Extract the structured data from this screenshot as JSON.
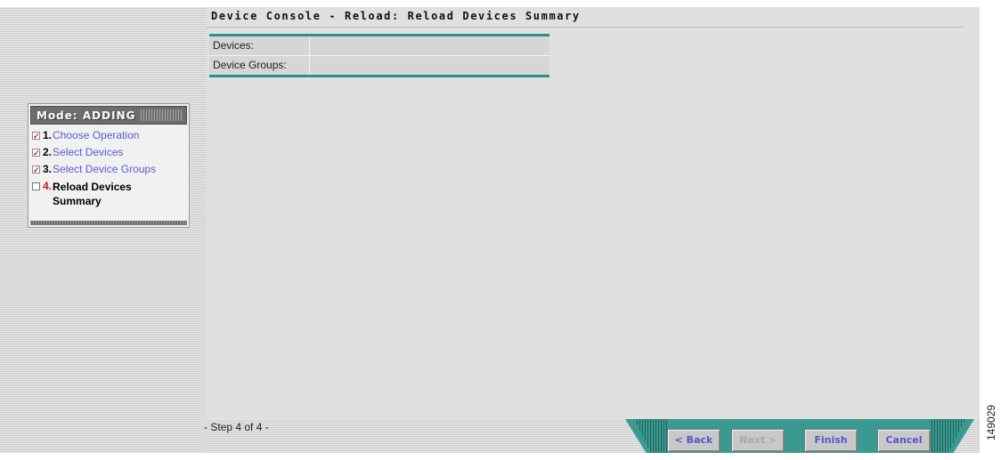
{
  "header": {
    "title": "Device Console - Reload: Reload Devices Summary"
  },
  "summary": {
    "rows": [
      {
        "label": "Devices:",
        "value": ""
      },
      {
        "label": "Device Groups:",
        "value": ""
      }
    ]
  },
  "wizard": {
    "mode_label": "Mode: ADDING",
    "steps": [
      {
        "number": "1.",
        "label": "Choose Operation",
        "done": true
      },
      {
        "number": "2.",
        "label": "Select Devices",
        "done": true
      },
      {
        "number": "3.",
        "label": "Select Device Groups",
        "done": true
      },
      {
        "number": "4.",
        "label_line1": "Reload Devices",
        "label_line2": "Summary",
        "done": false,
        "current": true
      }
    ]
  },
  "footer": {
    "step_text": "- Step 4 of 4 -",
    "buttons": {
      "back": "< Back",
      "next": "Next >",
      "finish": "Finish",
      "cancel": "Cancel"
    }
  },
  "side_id": "149029",
  "colors": {
    "accent_teal": "#3a9a91",
    "link_blue": "#5a5ad6",
    "current_red": "#d01818"
  }
}
